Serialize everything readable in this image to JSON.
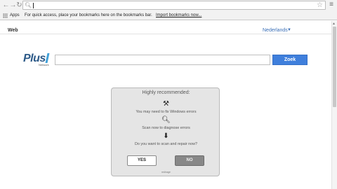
{
  "browser": {
    "back_icon": "←",
    "forward_icon": "→",
    "reload_icon": "↻",
    "search_icon": "🔍︎",
    "star_icon": "☆",
    "menu_icon": "≡",
    "address_value": ""
  },
  "bookmarks_bar": {
    "apps_label": "Apps",
    "hint": "For quick access, place your bookmarks here on the bookmarks bar.",
    "import_link": "Import bookmarks now..."
  },
  "page_header": {
    "tab_web": "Web",
    "language": "Nederlands",
    "language_arrow": "▼"
  },
  "search": {
    "logo_text": "Plus",
    "logo_subtext": "Network",
    "query": "",
    "button_label": "Zoek"
  },
  "dialog": {
    "title": "Highly recommended:",
    "line1_icon": "⚒",
    "line1": "You may need to fix Windows errors",
    "line2_icon": "🔍︎",
    "line2": "Scan now to diagnose errors",
    "line3_icon": "⬇",
    "line3": "Do you want to scan and repair now?",
    "yes_label": "YES",
    "no_label": "NO",
    "footer": "redirage"
  },
  "colors": {
    "accent": "#3f7fdc",
    "link": "#3a6fb7",
    "logo": "#2d5a88"
  }
}
